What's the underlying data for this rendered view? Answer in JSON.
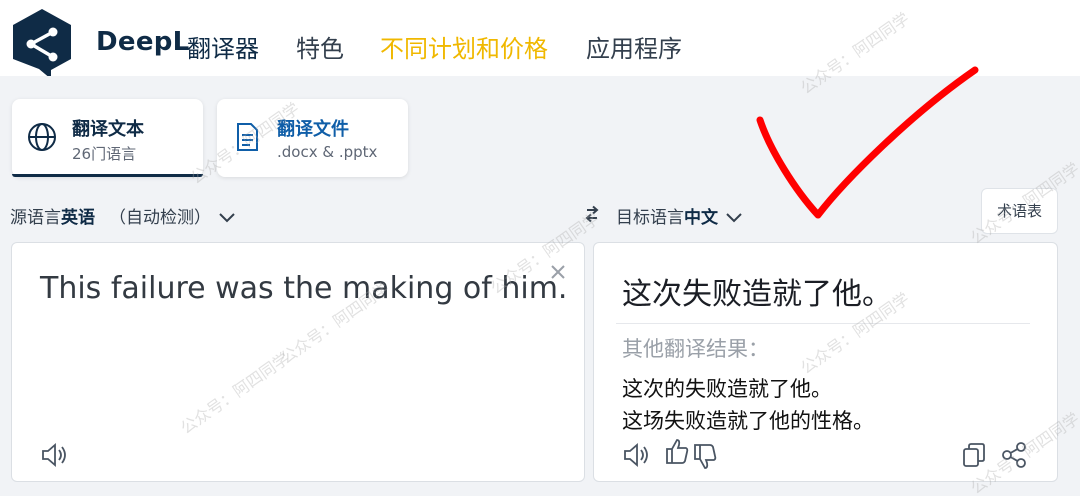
{
  "header": {
    "brand": "DeepL",
    "brand_sub": "翻译器",
    "nav": {
      "features": "特色",
      "pricing": "不同计划和价格",
      "apps": "应用程序"
    }
  },
  "tabs": {
    "text": {
      "title": "翻译文本",
      "subtitle": "26门语言",
      "icon": "globe-icon"
    },
    "docs": {
      "title": "翻译文件",
      "subtitle": ".docx & .pptx",
      "icon": "document-icon"
    }
  },
  "source": {
    "label_prefix": "源语言",
    "language": "英语",
    "auto_detect": "（自动检测）",
    "text": "This failure was the making of him."
  },
  "target": {
    "label_prefix": "目标语言",
    "language": "中文",
    "text": "这次失败造就了他。",
    "alternatives_label": "其他翻译结果：",
    "alternatives": [
      "这次的失败造就了他。",
      "这场失败造就了他的性格。"
    ]
  },
  "glossary_button": "术语表",
  "watermark": "公众号：阿四同学",
  "colors": {
    "brand_navy": "#0f2b46",
    "pricing_yellow": "#f0b800",
    "annotation_red": "#ff0000"
  }
}
